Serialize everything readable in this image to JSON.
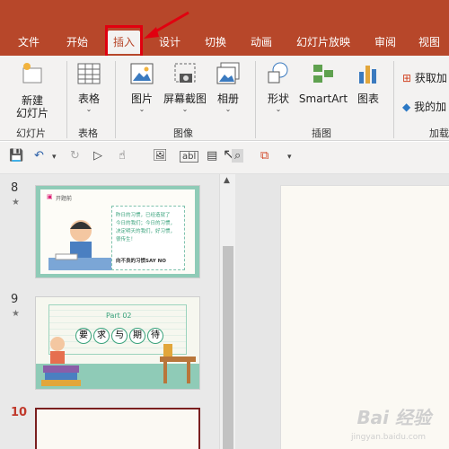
{
  "ribbon_tabs": [
    "文件",
    "开始",
    "插入",
    "设计",
    "切换",
    "动画",
    "幻灯片放映",
    "审阅",
    "视图"
  ],
  "active_tab": "插入",
  "ribbon": {
    "new_slide": [
      "新建",
      "幻灯片"
    ],
    "table": "表格",
    "picture": "图片",
    "screenshot": "屏幕截图",
    "album": "相册",
    "shapes": "形状",
    "smartart": "SmartArt",
    "chart": "图表",
    "get_addins": "获取加",
    "my_addins": "我的加",
    "groups": {
      "slides": "幻灯片",
      "tables": "表格",
      "images": "图像",
      "illustrations": "插图",
      "addins": "加载"
    }
  },
  "slides": [
    {
      "number": "8",
      "tag": "开题前",
      "lines": [
        "昨日的习惯，已经造就了",
        "今日的我们；今日的习惯，",
        "决定明天的我们，好习惯，",
        "很传生！"
      ],
      "footer": "向不良的习惯SAY NO"
    },
    {
      "number": "9",
      "part": "Part 02",
      "heading_chars": [
        "要",
        "求",
        "与",
        "期",
        "待"
      ]
    },
    {
      "number": "10"
    }
  ],
  "watermark": "Bai 经验",
  "watermark_sub": "jingyan.baidu.com",
  "colors": {
    "accent": "#b7472a",
    "highlight": "#e1000f"
  }
}
